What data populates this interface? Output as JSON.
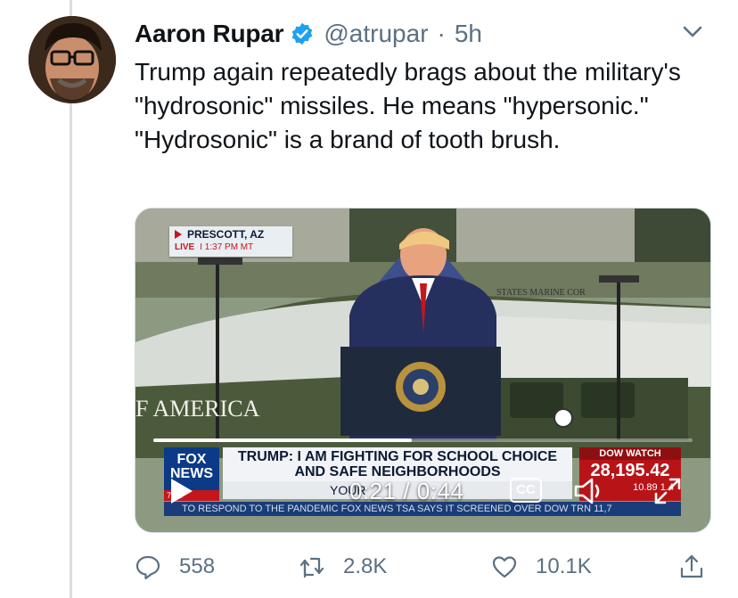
{
  "tweet": {
    "author_name": "Aaron Rupar",
    "handle": "@atrupar",
    "separator": "·",
    "time": "5h",
    "text": "Trump again repeatedly brags about the military's \"hydrosonic\" missiles. He means \"hypersonic.\" \"Hydrosonic\" is a brand of tooth brush.",
    "verified": true,
    "accent_color": "#1da1f2"
  },
  "video": {
    "location": "PRESCOTT, AZ",
    "live_label": "LIVE",
    "live_time": "I 1:37 PM MT",
    "helicopter_text": "F AMERICA",
    "marine_text": "STATES MARINE COR",
    "channel_logo": "FOX NEWS",
    "channel_sub": "7 PT",
    "headline": "TRUMP: I AM FIGHTING FOR SCHOOL CHOICE AND SAFE NEIGHBORHOODS",
    "subline": "YOUR",
    "ticker": "TO RESPOND TO THE PANDEMIC   FOX NEWS   TSA SAYS IT SCREENED OVER   DOW  TRN  11,7",
    "dow_title": "DOW WATCH",
    "dow_value": "28,195.42",
    "dow_change": "10.89  1.4",
    "current_time": "0:21",
    "duration": "0:44",
    "time_separator": " / ",
    "progress_fraction": 0.48,
    "cc_label": "CC"
  },
  "actions": {
    "replies": "558",
    "retweets": "2.8K",
    "likes": "10.1K"
  },
  "icons": {
    "verified": "verified-badge-icon",
    "caret": "chevron-down-icon",
    "reply": "reply-icon",
    "retweet": "retweet-icon",
    "like": "heart-icon",
    "share": "share-icon",
    "play": "play-icon",
    "volume": "volume-icon",
    "fullscreen": "fullscreen-icon"
  }
}
